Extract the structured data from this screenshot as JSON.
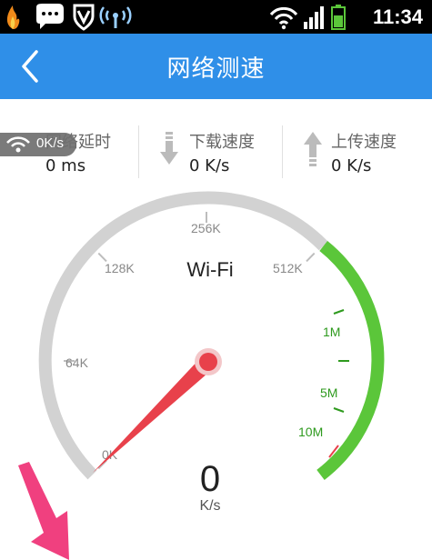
{
  "status_bar": {
    "time": "11:34",
    "icons": [
      "flame-icon",
      "chat-bubble-icon",
      "shield-v-icon",
      "wifi-broadcast-icon",
      "wifi-signal-icon",
      "cell-signal-icon",
      "battery-icon"
    ],
    "accent": "#000000"
  },
  "navbar": {
    "title": "网络测速",
    "back_icon": "chevron-left-icon",
    "color": "#2f8fe8"
  },
  "stats": {
    "latency_label": "网络延时",
    "latency_value": "0 ms",
    "download_label": "下载速度",
    "download_value": "0 K/s",
    "upload_label": "上传速度",
    "upload_value": "0 K/s"
  },
  "wifi_badge": {
    "text": "0K/s"
  },
  "gauge": {
    "network": "Wi-Fi",
    "ticks": [
      "0K",
      "64K",
      "128K",
      "256K",
      "512K",
      "1M",
      "5M",
      "10M"
    ],
    "speed_value": "0",
    "speed_unit": "K/s",
    "gray_color": "#d2d2d2",
    "green_color": "#5bc63a",
    "needle_color": "#e8414b"
  }
}
